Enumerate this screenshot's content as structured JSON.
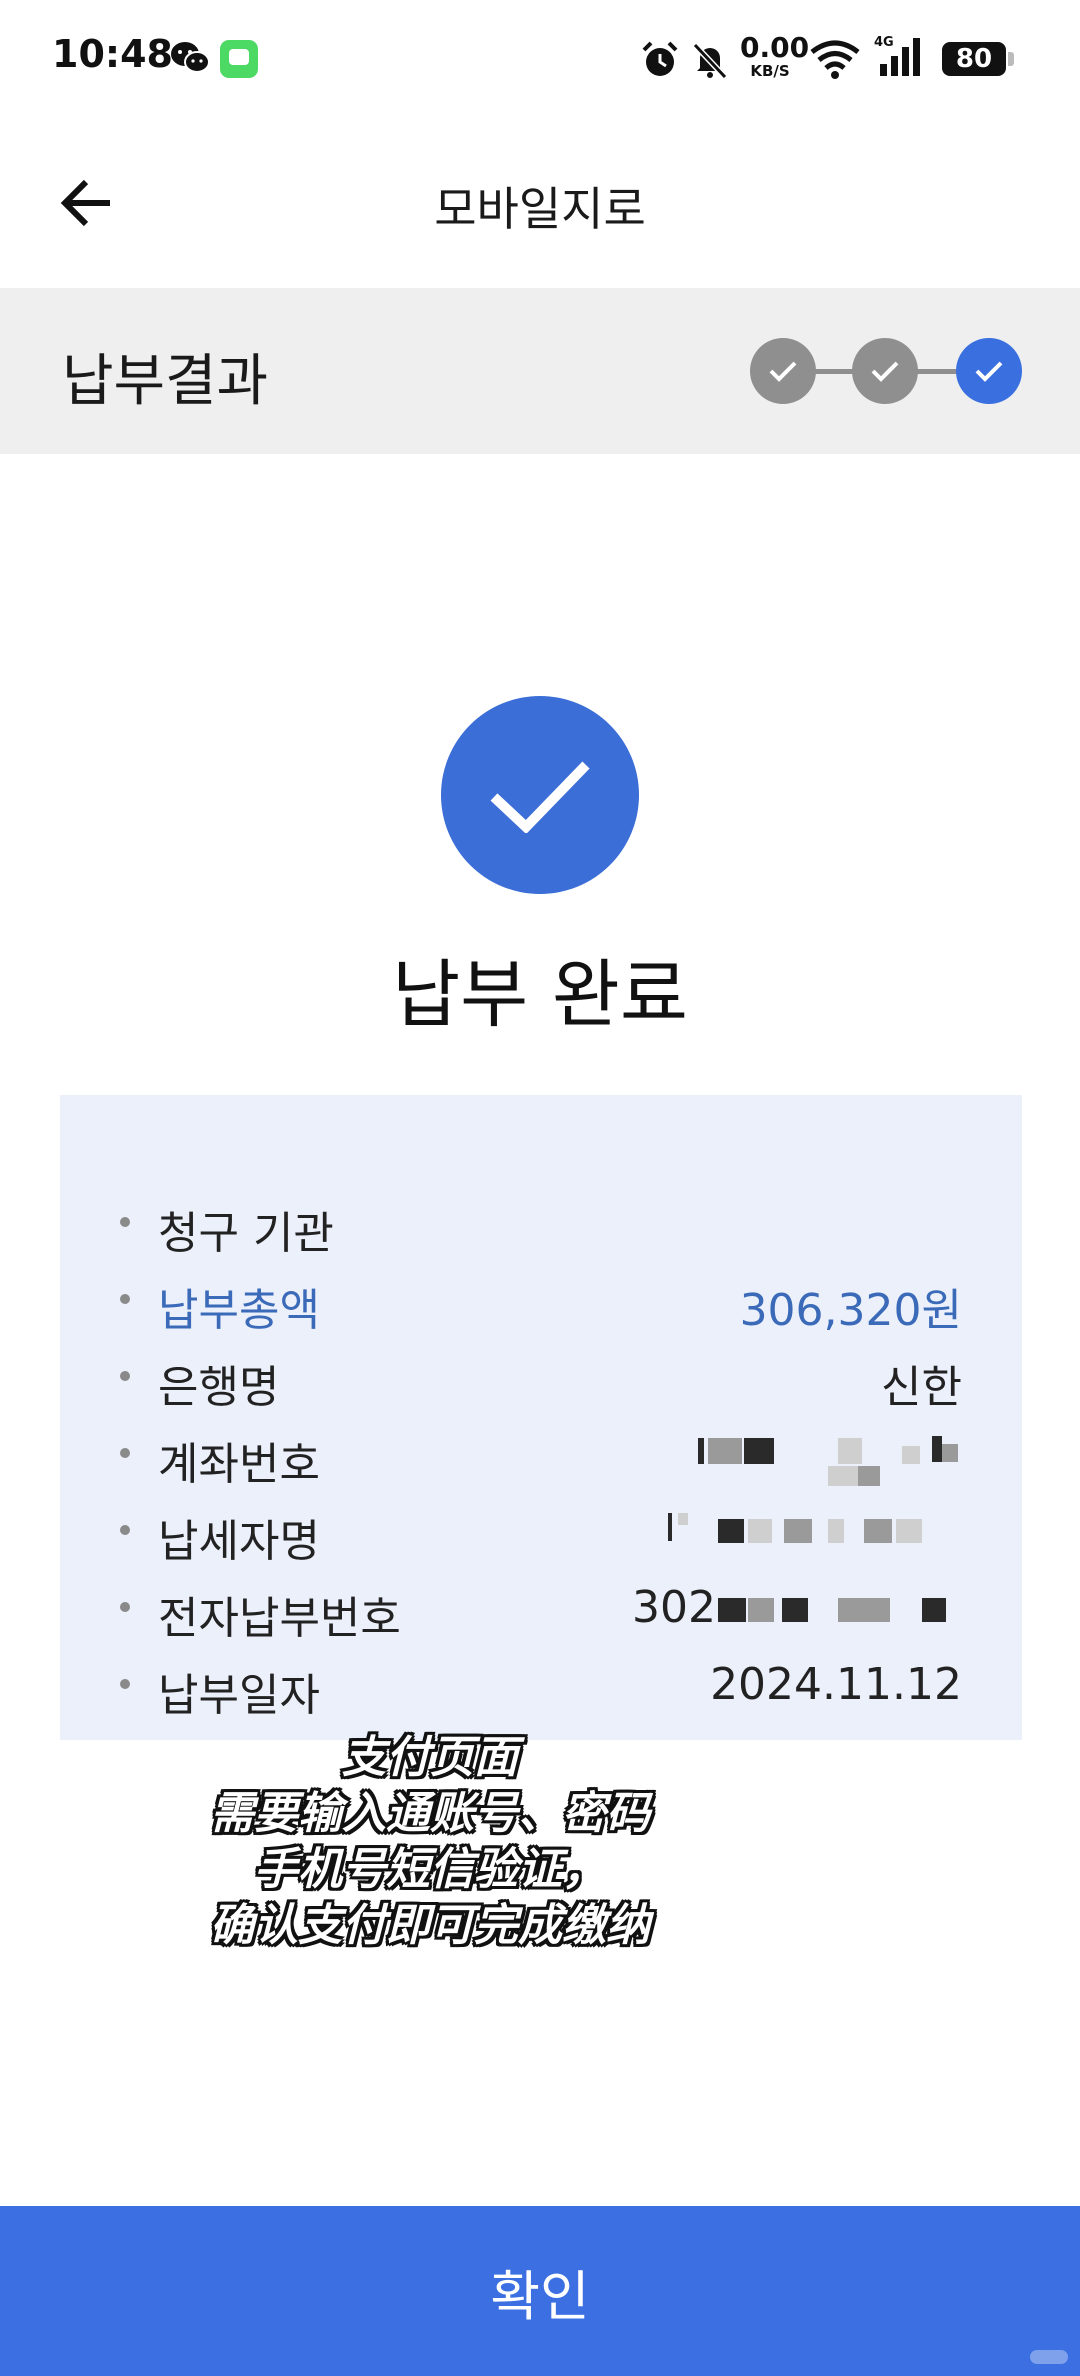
{
  "status_bar": {
    "time": "10:48",
    "net_speed_value": "0.00",
    "net_speed_unit": "KB/S",
    "network_type": "4G",
    "battery": "80",
    "icons": [
      "wechat-icon",
      "message-icon",
      "alarm-icon",
      "mute-icon",
      "wifi-icon",
      "signal-icon"
    ]
  },
  "header": {
    "title": "모바일지로",
    "back_icon": "arrow-left-icon"
  },
  "step_bar": {
    "title": "납부결과",
    "steps": [
      {
        "state": "done",
        "color": "#8f8f8f"
      },
      {
        "state": "done",
        "color": "#8f8f8f"
      },
      {
        "state": "current",
        "color": "#3a6fe0"
      }
    ]
  },
  "result": {
    "icon": "check-circle-icon",
    "title": "납부 완료",
    "accent_color": "#3b6ed6"
  },
  "details": {
    "rows": [
      {
        "label": "청구 기관",
        "value": ""
      },
      {
        "label": "납부총액",
        "value": "306,320원"
      },
      {
        "label": "은행명",
        "value": "신한"
      },
      {
        "label": "계좌번호",
        "value": ""
      },
      {
        "label": "납세자명",
        "value": ""
      },
      {
        "label": "전자납부번호",
        "value": "302"
      },
      {
        "label": "납부일자",
        "value": "2024.11.12"
      }
    ],
    "highlight_color": "#3b6ab8"
  },
  "caption": {
    "lines": [
      "支付页面",
      "需要输入通账号、密码",
      "手机号短信验证，",
      "确认支付即可完成缴纳"
    ]
  },
  "footer": {
    "confirm_label": "확인",
    "button_color": "#3b6fe2"
  }
}
